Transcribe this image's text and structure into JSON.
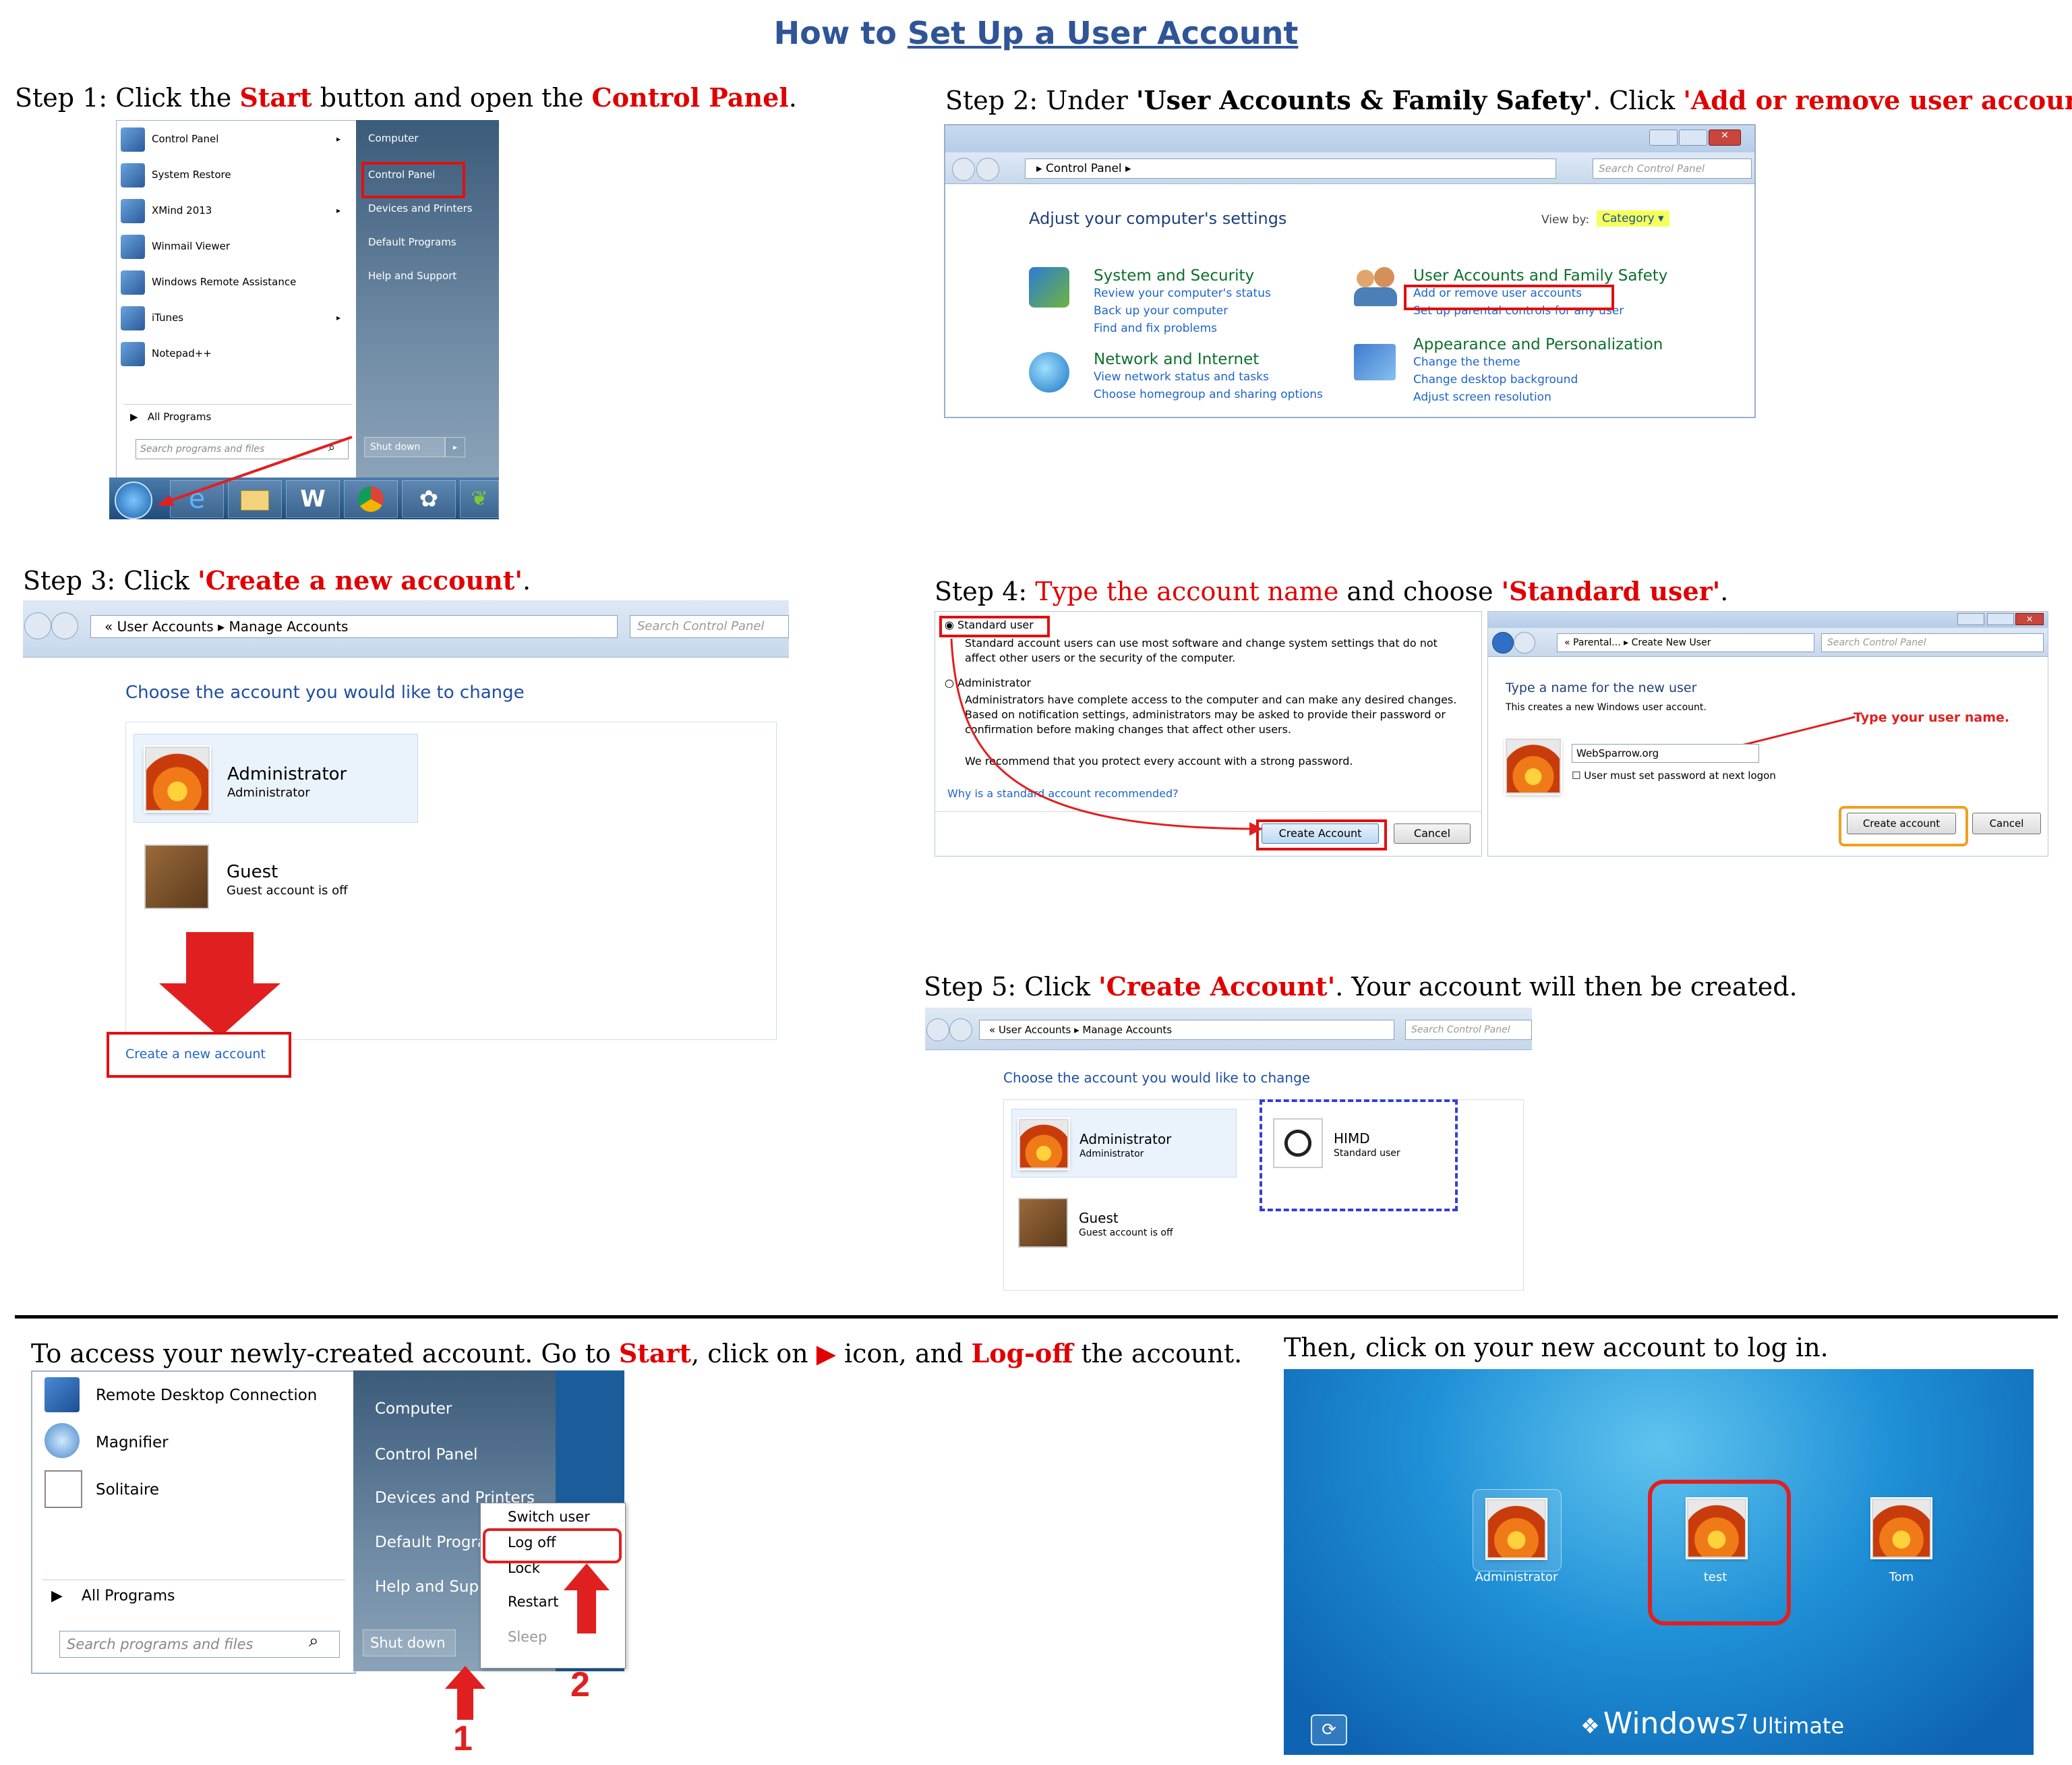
{
  "title": {
    "prefix": "How to ",
    "link": "Set Up a User Account"
  },
  "step1": {
    "text": {
      "a": "Step 1: Click the ",
      "b": "Start",
      "c": " button and open the ",
      "d": "Control Panel",
      "e": "."
    },
    "left_items": [
      "Control Panel",
      "System Restore",
      "XMind 2013",
      "Winmail Viewer",
      "Windows Remote Assistance",
      "iTunes",
      "Notepad++"
    ],
    "all_programs": "All Programs",
    "search_placeholder": "Search programs and files",
    "right_items": [
      "Computer",
      "Control Panel",
      "Devices and Printers",
      "Default Programs",
      "Help and Support"
    ],
    "shutdown": "Shut down"
  },
  "step2": {
    "text": {
      "a": "Step 2: Under ",
      "b": "'User Accounts & Family Safety'",
      "c": ". Click ",
      "d": "'Add or remove user accounts'",
      "e": "."
    },
    "address": "Control Panel",
    "search": "Search Control Panel",
    "heading": "Adjust your computer's settings",
    "viewby": "View by:",
    "category": "Category",
    "sections": [
      {
        "title": "System and Security",
        "links": [
          "Review your computer's status",
          "Back up your computer",
          "Find and fix problems"
        ]
      },
      {
        "title": "Network and Internet",
        "links": [
          "View network status and tasks",
          "Choose homegroup and sharing options"
        ]
      },
      {
        "title": "User Accounts and Family Safety",
        "links": [
          "Add or remove user accounts",
          "Set up parental controls for any user"
        ]
      },
      {
        "title": "Appearance and Personalization",
        "links": [
          "Change the theme",
          "Change desktop background",
          "Adjust screen resolution"
        ]
      }
    ]
  },
  "step3": {
    "text": {
      "a": "Step 3: Click ",
      "b": "'Create a new account'",
      "c": "."
    },
    "breadcrumb": [
      "User Accounts",
      "Manage Accounts"
    ],
    "search": "Search Control Panel",
    "heading": "Choose the account you would like to change",
    "accounts": [
      {
        "name": "Administrator",
        "role": "Administrator"
      },
      {
        "name": "Guest",
        "role": "Guest account is off"
      }
    ],
    "create_link": "Create a new account"
  },
  "step4": {
    "text": {
      "a": "Step 4: ",
      "b": "Type the account name",
      "c": " and choose ",
      "d": "'Standard user'",
      "e": "."
    },
    "standard": "Standard user",
    "standard_desc": "Standard account users can use most software and change system settings that do not affect other users or the security of the computer.",
    "admin": "Administrator",
    "admin_desc": "Administrators have complete access to the computer and can make any desired changes. Based on notification settings, administrators may be asked to provide their password or confirmation before making changes that affect other users.",
    "recommend": "We recommend that you protect every account with a strong password.",
    "why_link": "Why is a standard account recommended?",
    "create_btn": "Create Account",
    "cancel_btn": "Cancel",
    "breadcrumb": [
      "Parental...",
      "Create New User"
    ],
    "search": "Search Control Panel",
    "name_heading": "Type a name for the new user",
    "name_desc": "This creates a new Windows user account.",
    "type_note": "Type your user name.",
    "name_value": "WebSparrow.org",
    "checkbox": "User must set password at next logon",
    "create_btn2": "Create account",
    "cancel_btn2": "Cancel"
  },
  "step5": {
    "text": {
      "a": "Step 5: Click ",
      "b": "'Create Account'",
      "c": ". Your account will then be created."
    },
    "breadcrumb": [
      "User Accounts",
      "Manage Accounts"
    ],
    "search": "Search Control Panel",
    "heading": "Choose the account you would like to change",
    "accounts": [
      {
        "name": "Administrator",
        "role": "Administrator"
      },
      {
        "name": "HIMD",
        "role": "Standard user"
      },
      {
        "name": "Guest",
        "role": "Guest account is off"
      }
    ]
  },
  "access": {
    "text": {
      "a": "To access your newly-created account. Go to ",
      "b": "Start",
      "c": ", click on ",
      "d": "▶",
      "e": " icon, and ",
      "f": "Log-off",
      "g": " the account."
    },
    "left_items": [
      "Remote Desktop Connection",
      "Magnifier",
      "Solitaire"
    ],
    "all_programs": "All Programs",
    "search_placeholder": "Search programs and files",
    "right_items": [
      "Computer",
      "Control Panel",
      "Devices and Printers",
      "Default Program",
      "Help and Suppo"
    ],
    "shutdown": "Shut down",
    "menu": [
      "Switch user",
      "Log off",
      "Lock",
      "Restart",
      "Sleep"
    ],
    "num1": "1",
    "num2": "2"
  },
  "login": {
    "text": "Then, click on your new account to log in.",
    "users": [
      "Administrator",
      "test",
      "Tom"
    ],
    "brand": "Windows",
    "version": "7",
    "edition": "Ultimate"
  },
  "colors": {
    "title": "#2f5597",
    "highlight": "#e00000",
    "link": "#1e64c8"
  }
}
